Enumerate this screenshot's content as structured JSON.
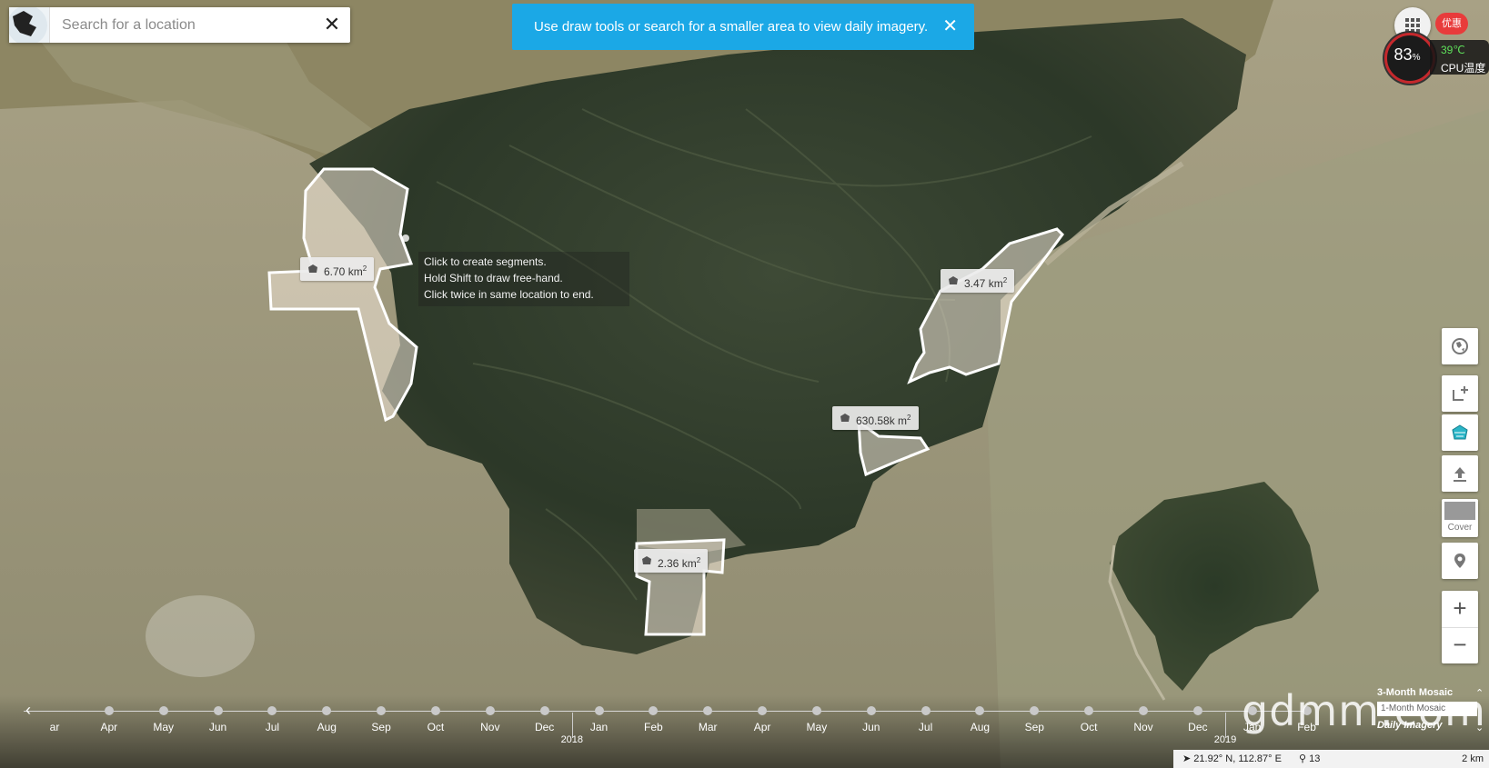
{
  "search": {
    "placeholder": "Search for a location"
  },
  "banner": {
    "text": "Use draw tools or search for a smaller area to view daily imagery."
  },
  "cpu": {
    "percent": "83",
    "percent_unit": "%",
    "temp": "39℃",
    "label": "CPU温度",
    "promo": "优惠"
  },
  "measurements": [
    {
      "value": "6.70 km",
      "exp": "2"
    },
    {
      "value": "3.47 km",
      "exp": "2"
    },
    {
      "value": "630.58k m",
      "exp": "2"
    },
    {
      "value": "2.36 km",
      "exp": "2"
    }
  ],
  "hint": {
    "line1": "Click to create segments.",
    "line2": "Hold Shift to draw free-hand.",
    "line3": "Click twice in same location to end."
  },
  "toolbar": {
    "cover_label": "Cover",
    "zoom_in": "+",
    "zoom_out": "−"
  },
  "timeline": {
    "months": [
      "ar",
      "Apr",
      "May",
      "Jun",
      "Jul",
      "Aug",
      "Sep",
      "Oct",
      "Nov",
      "Dec",
      "Jan",
      "Feb",
      "Mar",
      "Apr",
      "May",
      "Jun",
      "Jul",
      "Aug",
      "Sep",
      "Oct",
      "Nov",
      "Dec",
      "Jan",
      "Feb"
    ],
    "years": [
      "2018",
      "2019"
    ]
  },
  "imagery": {
    "title": "3-Month Mosaic",
    "select_value": "1-Month Mosaic",
    "daily": "Daily Imagery"
  },
  "watermark": "gdmm.com",
  "status": {
    "coords": "21.92° N, 112.87° E",
    "zoom": "13",
    "scale": "2 km"
  },
  "colors": {
    "banner": "#1ba8e6",
    "water": "#a59c7c",
    "land": "#2f3a2a"
  }
}
